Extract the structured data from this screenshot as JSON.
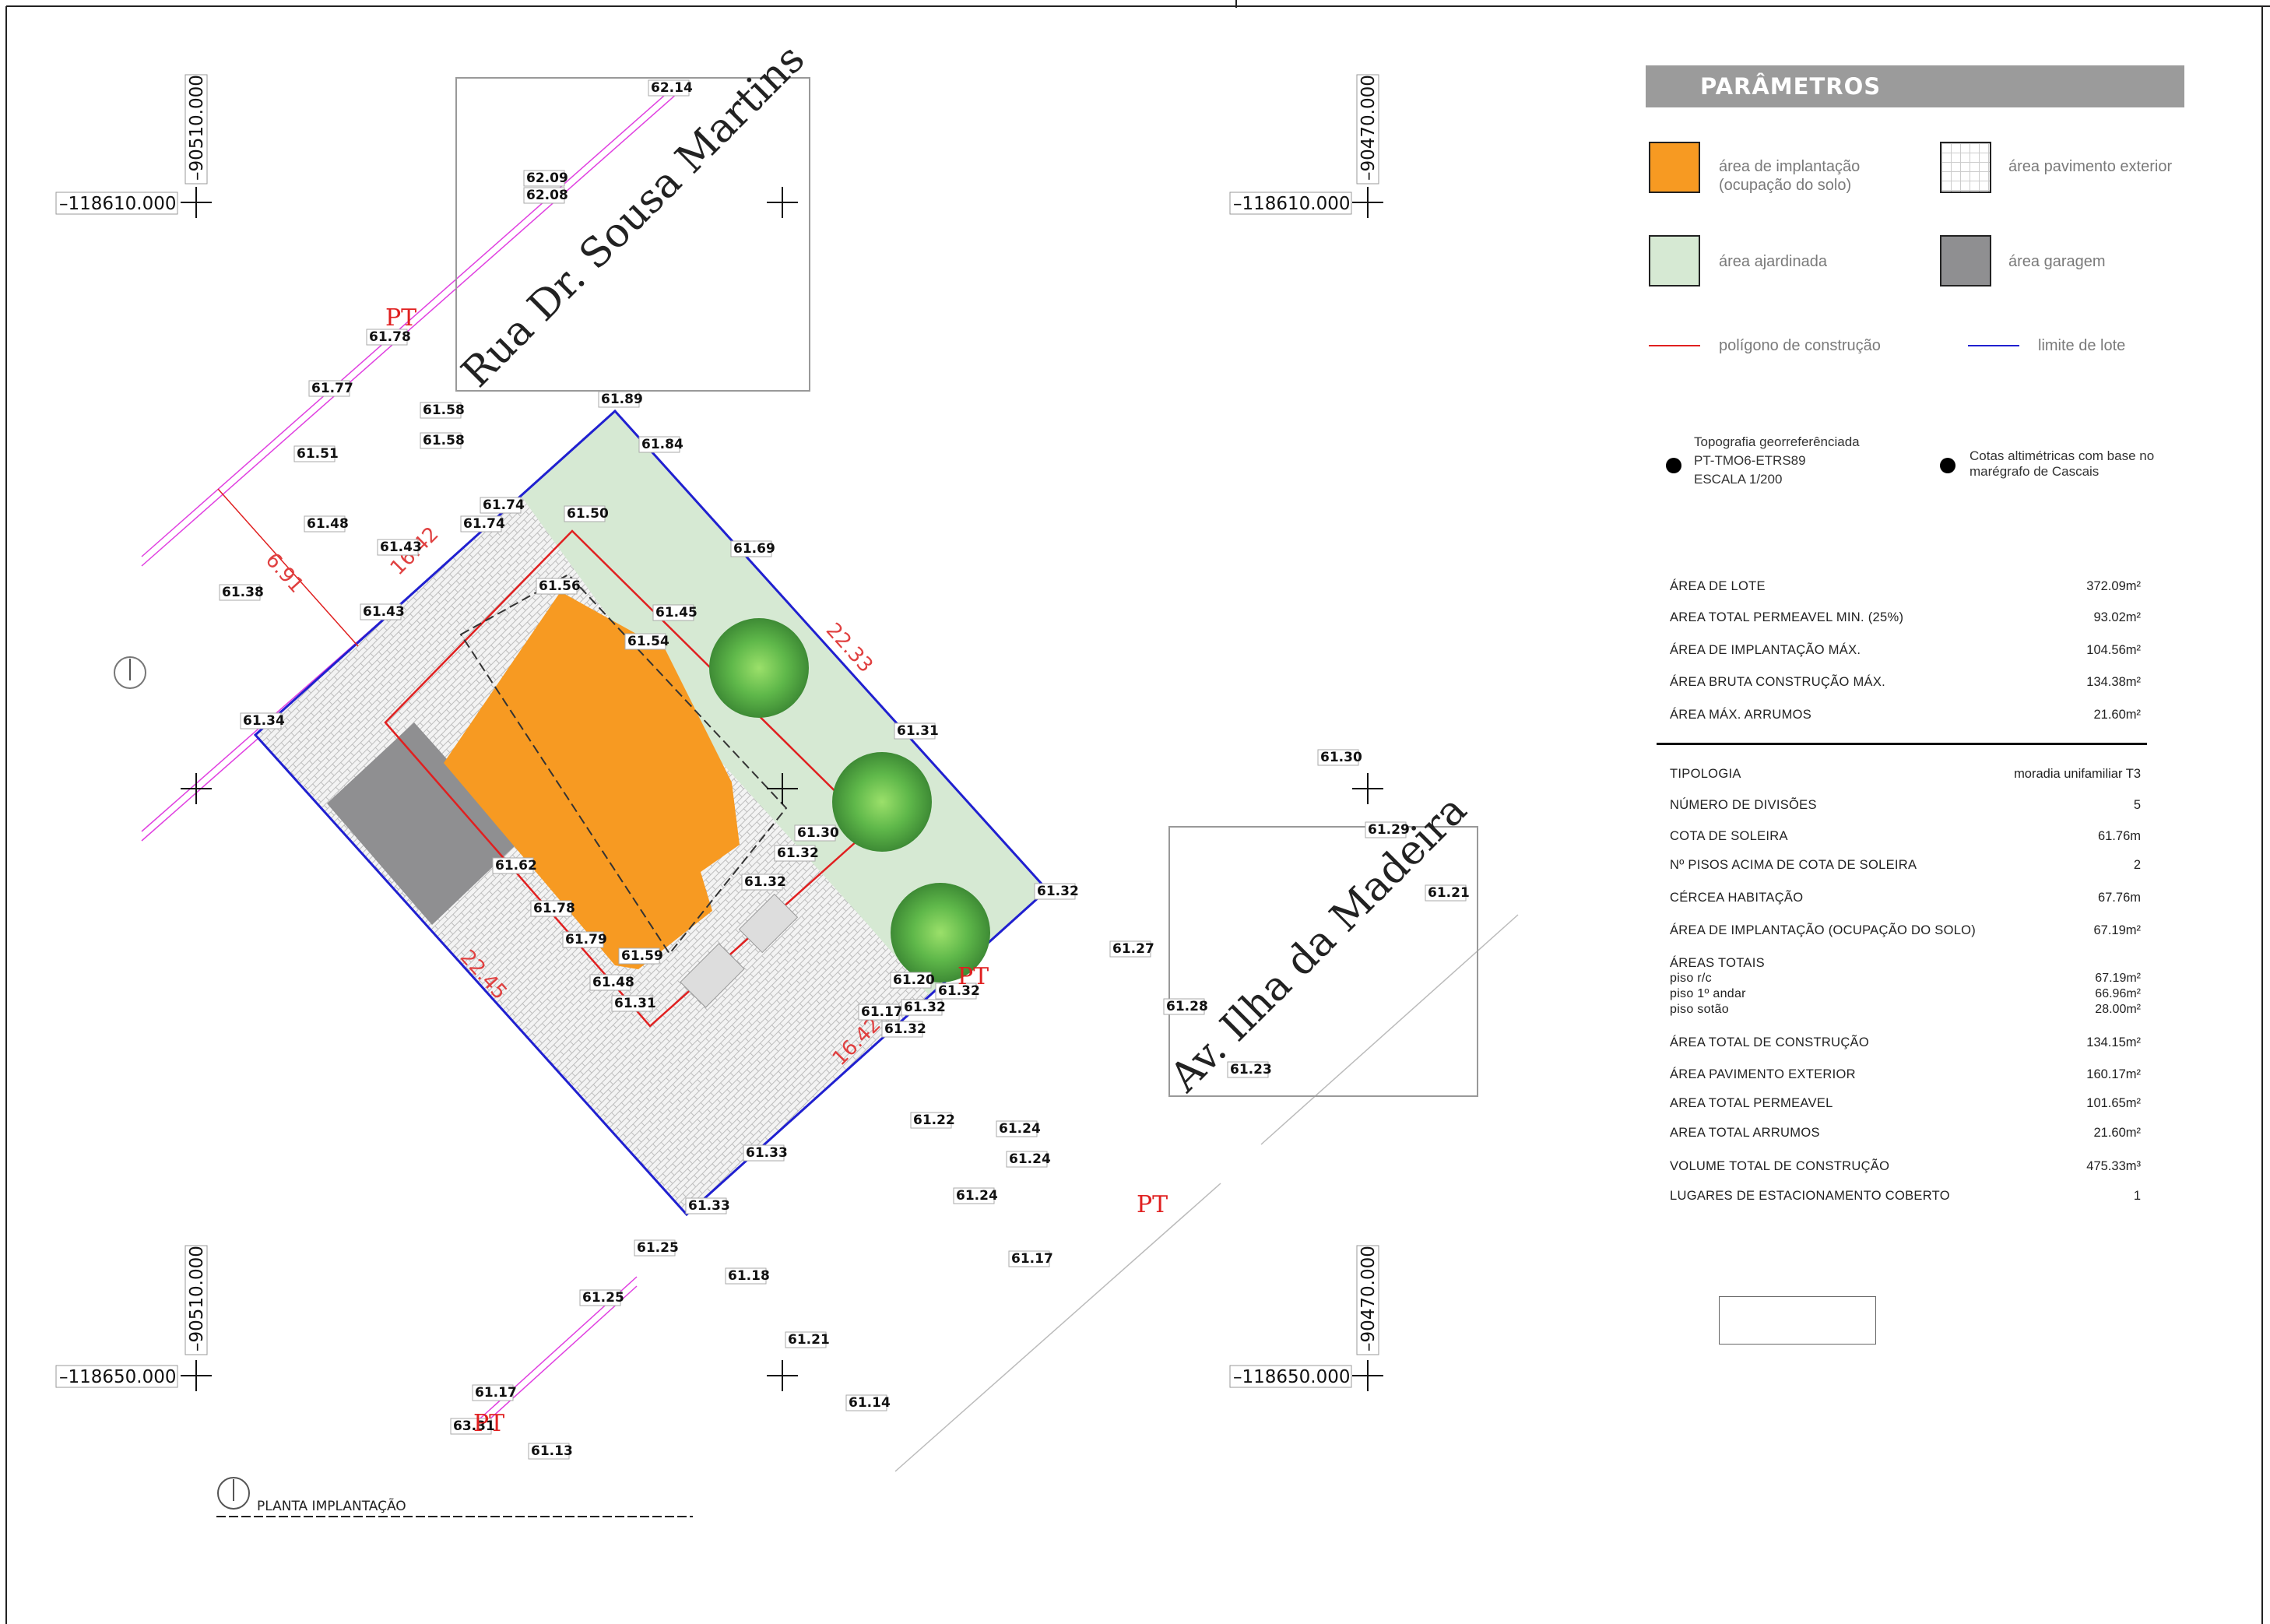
{
  "legend": {
    "title": "PARÂMETROS",
    "items": [
      {
        "name": "implantacao",
        "label": "área de implantação\n(ocupação do solo)",
        "color": "#f79a22"
      },
      {
        "name": "pavimento",
        "label": "área pavimento exterior",
        "color": "#ffffff"
      },
      {
        "name": "ajardinada",
        "label": "área ajardinada",
        "color": "#d6e9d3"
      },
      {
        "name": "garagem",
        "label": "área garagem",
        "color": "#8f8f91"
      }
    ],
    "lines": [
      {
        "name": "poligono",
        "label": "polígono de construção",
        "color": "#e02020"
      },
      {
        "name": "limite",
        "label": "limite de lote",
        "color": "#2020d0"
      }
    ],
    "topo_left": [
      "Topografia georreferênciada",
      "PT-TMO6-ETRS89",
      "ESCALA 1/200"
    ],
    "topo_right": [
      "Cotas altimétricas com base no",
      "marégrafo de Cascais"
    ]
  },
  "table1": [
    {
      "k": "ÁREA DE LOTE",
      "v": "372.09m²"
    },
    {
      "k": "AREA TOTAL PERMEAVEL MIN. (25%)",
      "v": "93.02m²"
    },
    {
      "k": "ÁREA DE IMPLANTAÇÃO MÁX.",
      "v": "104.56m²"
    },
    {
      "k": "ÁREA BRUTA CONSTRUÇÃO MÁX.",
      "v": "134.38m²"
    },
    {
      "k": "ÁREA MÁX. ARRUMOS",
      "v": "21.60m²"
    }
  ],
  "table2": [
    {
      "k": "TIPOLOGIA",
      "v": "moradia unifamiliar T3"
    },
    {
      "k": "NÚMERO DE DIVISÕES",
      "v": "5"
    },
    {
      "k": "COTA DE SOLEIRA",
      "v": "61.76m"
    },
    {
      "k": "Nº PISOS ACIMA DE COTA DE SOLEIRA",
      "v": "2"
    },
    {
      "k": "CÉRCEA HABITAÇÃO",
      "v": "67.76m"
    },
    {
      "k": "ÁREA DE IMPLANTAÇÃO (OCUPAÇÃO DO SOLO)",
      "v": "67.19m²"
    },
    {
      "k": "ÁREAS TOTAIS",
      "v": ""
    },
    {
      "k": "piso r/c",
      "v": "67.19m²"
    },
    {
      "k": "piso 1º andar",
      "v": "66.96m²"
    },
    {
      "k": "piso sotão",
      "v": "28.00m²"
    },
    {
      "k": "ÁREA TOTAL DE CONSTRUÇÃO",
      "v": "134.15m²"
    },
    {
      "k": "ÁREA PAVIMENTO EXTERIOR",
      "v": "160.17m²"
    },
    {
      "k": "AREA TOTAL PERMEAVEL",
      "v": "101.65m²"
    },
    {
      "k": "AREA TOTAL ARRUMOS",
      "v": "21.60m²"
    },
    {
      "k": "VOLUME TOTAL DE CONSTRUÇÃO",
      "v": "475.33m³"
    },
    {
      "k": "LUGARES DE ESTACIONAMENTO COBERTO",
      "v": "1"
    }
  ],
  "coords": {
    "x_left": "–118610.000",
    "x_left_bottom": "–118650.000",
    "x_right": "–118610.000",
    "x_right_bottom": "–118650.000",
    "y_left": "–90510.000",
    "y_right": "–90470.000"
  },
  "streets": {
    "north": "Rua Dr. Sousa Martins",
    "east": "Av. Ilha da Madeira"
  },
  "plan_label": "PLANTA IMPLANTAÇÃO",
  "pt_label": "PT",
  "dims": [
    "6.91",
    "16.42",
    "22.33",
    "22.45",
    "16.42"
  ],
  "spot_levels": [
    "62.14",
    "62.09",
    "62.08",
    "61.78",
    "61.77",
    "61.58",
    "61.58",
    "61.51",
    "61.89",
    "61.84",
    "61.74",
    "61.74",
    "61.50",
    "61.48",
    "61.43",
    "61.38",
    "61.69",
    "61.56",
    "61.43",
    "61.45",
    "61.54",
    "61.34",
    "61.31",
    "61.30",
    "61.32",
    "61.30",
    "61.32",
    "61.29",
    "61.21",
    "61.32",
    "61.62",
    "61.32",
    "61.78",
    "61.79",
    "61.59",
    "61.48",
    "61.31",
    "61.27",
    "61.20",
    "61.17",
    "61.32",
    "61.32",
    "61.28",
    "61.23",
    "61.22",
    "61.24",
    "61.24",
    "61.33",
    "61.24",
    "61.33",
    "61.25",
    "61.18",
    "61.17",
    "61.25",
    "61.21",
    "61.17",
    "61.14",
    "63.31",
    "61.13"
  ]
}
